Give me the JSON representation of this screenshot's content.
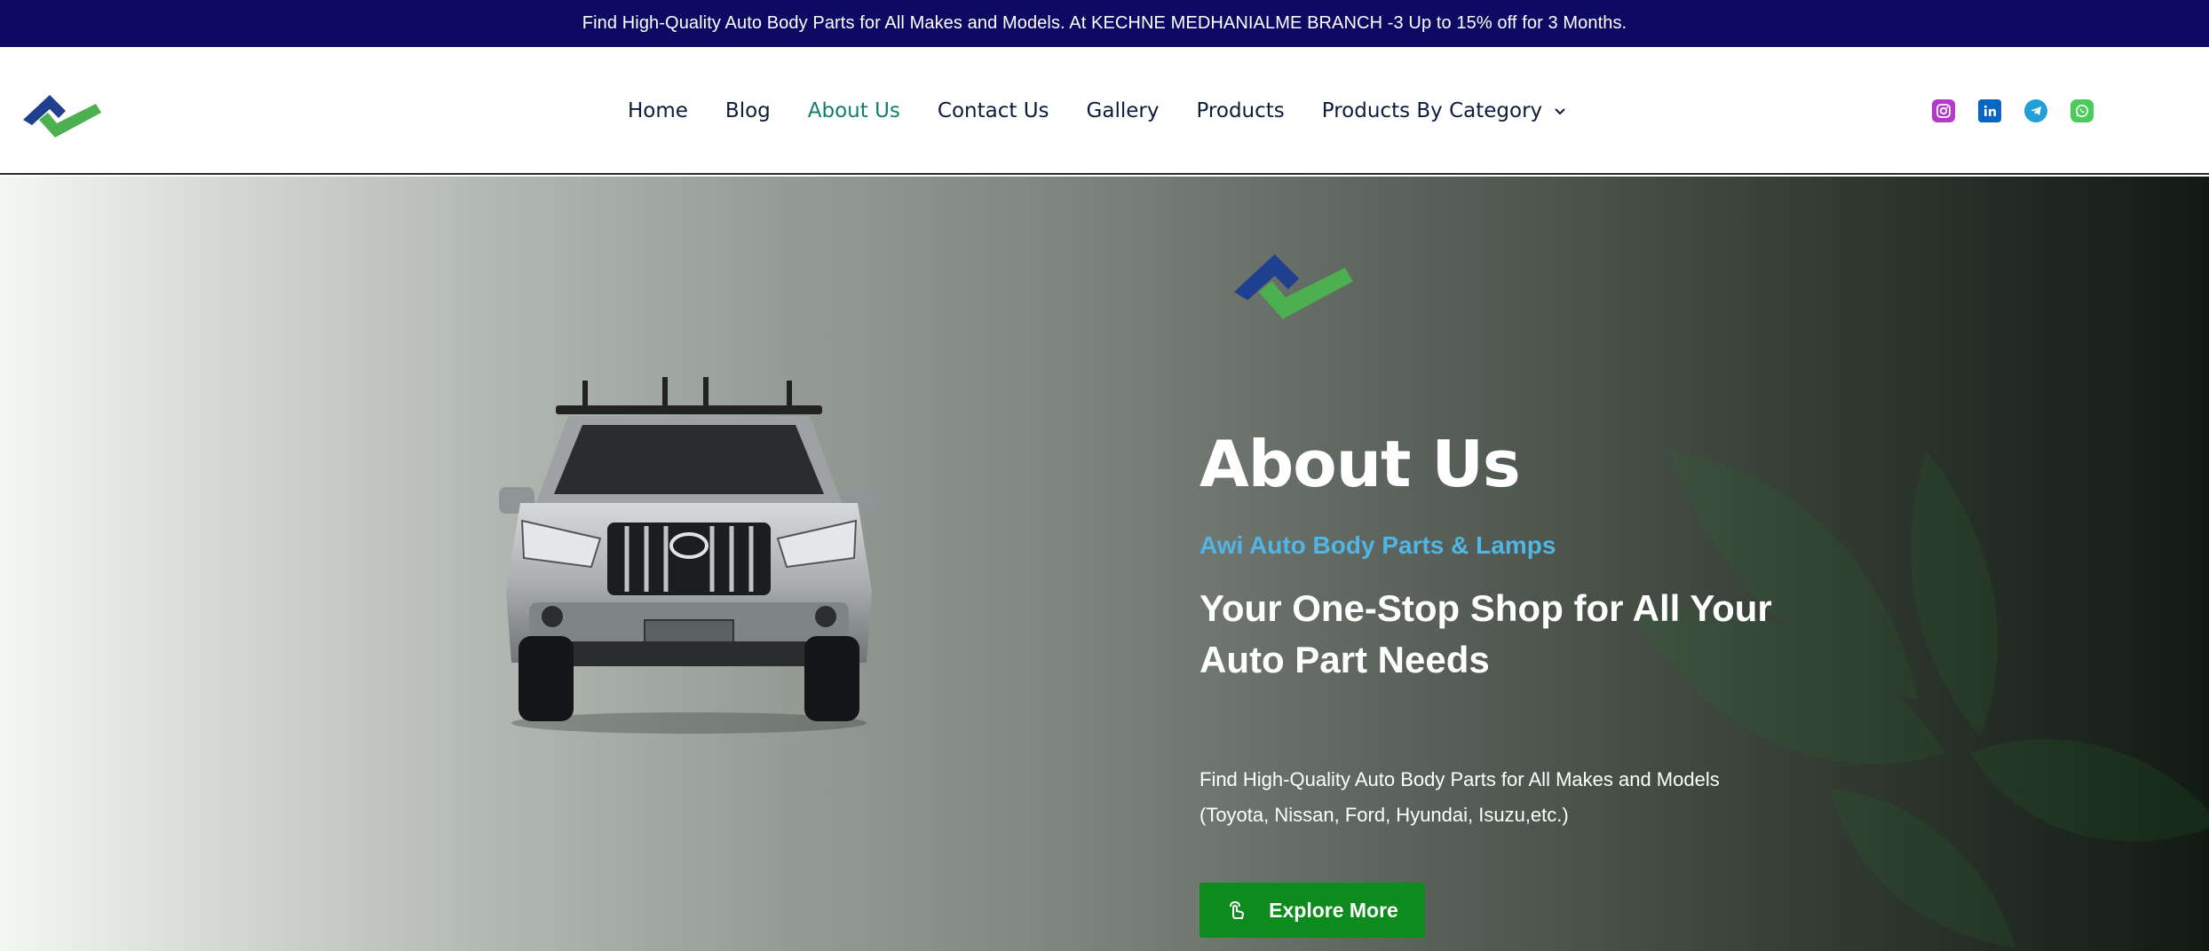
{
  "announcement": "Find High-Quality Auto Body Parts for All Makes and Models. At KECHNE MEDHANIALME BRANCH -3 Up to 15% off for 3 Months.",
  "brand": {
    "logo_alt": "Awi Auto Body Parts & Lamps logo",
    "colors": {
      "blue": "#1f3f8f",
      "green": "#4caf50"
    }
  },
  "nav": {
    "items": [
      {
        "label": "Home",
        "active": false
      },
      {
        "label": "Blog",
        "active": false
      },
      {
        "label": "About Us",
        "active": true
      },
      {
        "label": "Contact Us",
        "active": false
      },
      {
        "label": "Gallery",
        "active": false
      },
      {
        "label": "Products",
        "active": false
      },
      {
        "label": "Products By Category",
        "active": false,
        "dropdown": true
      }
    ]
  },
  "socials": [
    {
      "name": "instagram-icon",
      "color": "#b23bc9"
    },
    {
      "name": "linkedin-icon",
      "color": "#0a66c2"
    },
    {
      "name": "telegram-icon",
      "color": "#229ed9"
    },
    {
      "name": "whatsapp-icon",
      "color": "#4cca5a"
    }
  ],
  "hero": {
    "title": "About Us",
    "subtitle": "Awi Auto Body Parts & Lamps",
    "tagline": "Your One-Stop Shop for All Your Auto Part Needs",
    "description": "Find High-Quality Auto Body Parts for All Makes and Models (Toyota, Nissan, Ford, Hyundai, Isuzu,etc.)",
    "cta_label": "Explore More",
    "cta_color": "#0d8c1d",
    "subtitle_color": "#4fb6e6"
  }
}
